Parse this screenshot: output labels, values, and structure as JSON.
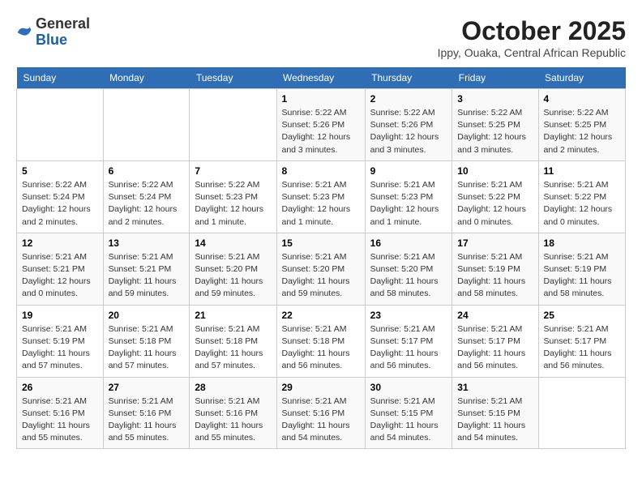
{
  "header": {
    "logo_general": "General",
    "logo_blue": "Blue",
    "month_title": "October 2025",
    "location": "Ippy, Ouaka, Central African Republic"
  },
  "weekdays": [
    "Sunday",
    "Monday",
    "Tuesday",
    "Wednesday",
    "Thursday",
    "Friday",
    "Saturday"
  ],
  "weeks": [
    [
      {
        "day": "",
        "info": ""
      },
      {
        "day": "",
        "info": ""
      },
      {
        "day": "",
        "info": ""
      },
      {
        "day": "1",
        "info": "Sunrise: 5:22 AM\nSunset: 5:26 PM\nDaylight: 12 hours\nand 3 minutes."
      },
      {
        "day": "2",
        "info": "Sunrise: 5:22 AM\nSunset: 5:26 PM\nDaylight: 12 hours\nand 3 minutes."
      },
      {
        "day": "3",
        "info": "Sunrise: 5:22 AM\nSunset: 5:25 PM\nDaylight: 12 hours\nand 3 minutes."
      },
      {
        "day": "4",
        "info": "Sunrise: 5:22 AM\nSunset: 5:25 PM\nDaylight: 12 hours\nand 2 minutes."
      }
    ],
    [
      {
        "day": "5",
        "info": "Sunrise: 5:22 AM\nSunset: 5:24 PM\nDaylight: 12 hours\nand 2 minutes."
      },
      {
        "day": "6",
        "info": "Sunrise: 5:22 AM\nSunset: 5:24 PM\nDaylight: 12 hours\nand 2 minutes."
      },
      {
        "day": "7",
        "info": "Sunrise: 5:22 AM\nSunset: 5:23 PM\nDaylight: 12 hours\nand 1 minute."
      },
      {
        "day": "8",
        "info": "Sunrise: 5:21 AM\nSunset: 5:23 PM\nDaylight: 12 hours\nand 1 minute."
      },
      {
        "day": "9",
        "info": "Sunrise: 5:21 AM\nSunset: 5:23 PM\nDaylight: 12 hours\nand 1 minute."
      },
      {
        "day": "10",
        "info": "Sunrise: 5:21 AM\nSunset: 5:22 PM\nDaylight: 12 hours\nand 0 minutes."
      },
      {
        "day": "11",
        "info": "Sunrise: 5:21 AM\nSunset: 5:22 PM\nDaylight: 12 hours\nand 0 minutes."
      }
    ],
    [
      {
        "day": "12",
        "info": "Sunrise: 5:21 AM\nSunset: 5:21 PM\nDaylight: 12 hours\nand 0 minutes."
      },
      {
        "day": "13",
        "info": "Sunrise: 5:21 AM\nSunset: 5:21 PM\nDaylight: 11 hours\nand 59 minutes."
      },
      {
        "day": "14",
        "info": "Sunrise: 5:21 AM\nSunset: 5:20 PM\nDaylight: 11 hours\nand 59 minutes."
      },
      {
        "day": "15",
        "info": "Sunrise: 5:21 AM\nSunset: 5:20 PM\nDaylight: 11 hours\nand 59 minutes."
      },
      {
        "day": "16",
        "info": "Sunrise: 5:21 AM\nSunset: 5:20 PM\nDaylight: 11 hours\nand 58 minutes."
      },
      {
        "day": "17",
        "info": "Sunrise: 5:21 AM\nSunset: 5:19 PM\nDaylight: 11 hours\nand 58 minutes."
      },
      {
        "day": "18",
        "info": "Sunrise: 5:21 AM\nSunset: 5:19 PM\nDaylight: 11 hours\nand 58 minutes."
      }
    ],
    [
      {
        "day": "19",
        "info": "Sunrise: 5:21 AM\nSunset: 5:19 PM\nDaylight: 11 hours\nand 57 minutes."
      },
      {
        "day": "20",
        "info": "Sunrise: 5:21 AM\nSunset: 5:18 PM\nDaylight: 11 hours\nand 57 minutes."
      },
      {
        "day": "21",
        "info": "Sunrise: 5:21 AM\nSunset: 5:18 PM\nDaylight: 11 hours\nand 57 minutes."
      },
      {
        "day": "22",
        "info": "Sunrise: 5:21 AM\nSunset: 5:18 PM\nDaylight: 11 hours\nand 56 minutes."
      },
      {
        "day": "23",
        "info": "Sunrise: 5:21 AM\nSunset: 5:17 PM\nDaylight: 11 hours\nand 56 minutes."
      },
      {
        "day": "24",
        "info": "Sunrise: 5:21 AM\nSunset: 5:17 PM\nDaylight: 11 hours\nand 56 minutes."
      },
      {
        "day": "25",
        "info": "Sunrise: 5:21 AM\nSunset: 5:17 PM\nDaylight: 11 hours\nand 56 minutes."
      }
    ],
    [
      {
        "day": "26",
        "info": "Sunrise: 5:21 AM\nSunset: 5:16 PM\nDaylight: 11 hours\nand 55 minutes."
      },
      {
        "day": "27",
        "info": "Sunrise: 5:21 AM\nSunset: 5:16 PM\nDaylight: 11 hours\nand 55 minutes."
      },
      {
        "day": "28",
        "info": "Sunrise: 5:21 AM\nSunset: 5:16 PM\nDaylight: 11 hours\nand 55 minutes."
      },
      {
        "day": "29",
        "info": "Sunrise: 5:21 AM\nSunset: 5:16 PM\nDaylight: 11 hours\nand 54 minutes."
      },
      {
        "day": "30",
        "info": "Sunrise: 5:21 AM\nSunset: 5:15 PM\nDaylight: 11 hours\nand 54 minutes."
      },
      {
        "day": "31",
        "info": "Sunrise: 5:21 AM\nSunset: 5:15 PM\nDaylight: 11 hours\nand 54 minutes."
      },
      {
        "day": "",
        "info": ""
      }
    ]
  ]
}
